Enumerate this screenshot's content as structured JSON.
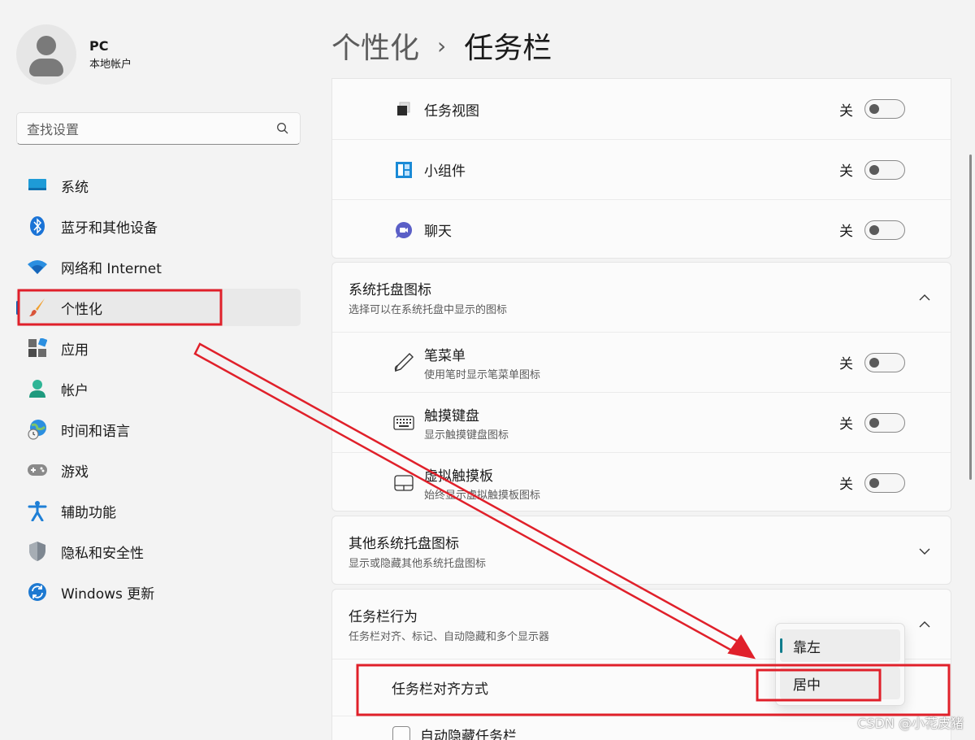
{
  "user": {
    "name": "PC",
    "account_type": "本地帐户"
  },
  "search": {
    "placeholder": "查找设置"
  },
  "nav": [
    {
      "label": "系统",
      "icon": "monitor-icon"
    },
    {
      "label": "蓝牙和其他设备",
      "icon": "bluetooth-icon"
    },
    {
      "label": "网络和 Internet",
      "icon": "wifi-icon"
    },
    {
      "label": "个性化",
      "icon": "brush-icon",
      "active": true
    },
    {
      "label": "应用",
      "icon": "apps-icon"
    },
    {
      "label": "帐户",
      "icon": "person-icon"
    },
    {
      "label": "时间和语言",
      "icon": "globe-clock-icon"
    },
    {
      "label": "游戏",
      "icon": "gamepad-icon"
    },
    {
      "label": "辅助功能",
      "icon": "accessibility-icon"
    },
    {
      "label": "隐私和安全性",
      "icon": "shield-icon"
    },
    {
      "label": "Windows 更新",
      "icon": "update-icon"
    }
  ],
  "breadcrumb": {
    "parent": "个性化",
    "separator": "›",
    "current": "任务栏"
  },
  "taskbar_items": [
    {
      "title": "任务视图",
      "state": "关",
      "icon": "task-view-icon"
    },
    {
      "title": "小组件",
      "state": "关",
      "icon": "widgets-icon"
    },
    {
      "title": "聊天",
      "state": "关",
      "icon": "chat-icon"
    }
  ],
  "tray_icons": {
    "title": "系统托盘图标",
    "subtitle": "选择可以在系统托盘中显示的图标",
    "expanded": true,
    "items": [
      {
        "title": "笔菜单",
        "subtitle": "使用笔时显示笔菜单图标",
        "state": "关",
        "icon": "pen-icon"
      },
      {
        "title": "触摸键盘",
        "subtitle": "显示触摸键盘图标",
        "state": "关",
        "icon": "keyboard-icon"
      },
      {
        "title": "虚拟触摸板",
        "subtitle": "始终显示虚拟触摸板图标",
        "state": "关",
        "icon": "touchpad-icon"
      }
    ]
  },
  "other_tray": {
    "title": "其他系统托盘图标",
    "subtitle": "显示或隐藏其他系统托盘图标",
    "expanded": false
  },
  "behavior": {
    "title": "任务栏行为",
    "subtitle": "任务栏对齐、标记、自动隐藏和多个显示器",
    "expanded": true,
    "alignment_label": "任务栏对齐方式",
    "alignment_options": [
      "靠左",
      "居中"
    ],
    "alignment_selected": "靠左",
    "autohide_label": "自动隐藏任务栏"
  },
  "watermark": "CSDN @小花皮猪",
  "colors": {
    "accent": "#005fb8",
    "annotation": "#e0202a",
    "selected_marker": "#0f7c8c"
  }
}
